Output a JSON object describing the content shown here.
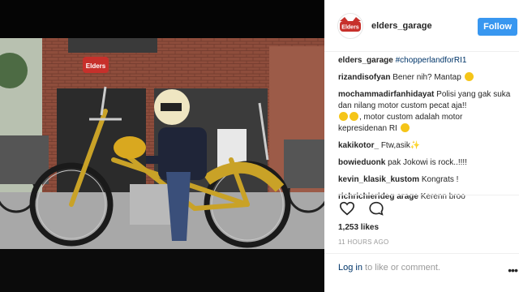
{
  "colors": {
    "accent": "#3897f0",
    "link": "#003569",
    "muted": "#999999",
    "text": "#262626"
  },
  "photo": {
    "shop_sign": "Elders",
    "icons": [
      "motorcycle-photo"
    ]
  },
  "header": {
    "avatar_text": "Elders",
    "username": "elders_garage",
    "follow_label": "Follow"
  },
  "caption": {
    "user": "elders_garage",
    "hashtag": "#chopperlandforRI1"
  },
  "comments": [
    {
      "user": "rizandisofyan",
      "text": "Bener nih? Mantap"
    },
    {
      "user": "mochammadirfanhidayat",
      "text": "Polisi yang gak suka dan nilang motor custom pecat aja!!",
      "text2": ", motor custom adalah motor kepresidenan RI"
    },
    {
      "user": "kakikotor_",
      "text": "Ftw,asik✨"
    },
    {
      "user": "bowieduonk",
      "text": "pak Jokowi is rock..!!!!"
    },
    {
      "user": "kevin_klasik_kustom",
      "text": "Kongrats !"
    },
    {
      "user": "richrichierideg arage",
      "text": "Kerenn broo"
    }
  ],
  "actions": {
    "icons": [
      "heart-icon",
      "comment-icon"
    ]
  },
  "likes": "1,253 likes",
  "timestamp": "11 HOURS AGO",
  "login": {
    "link": "Log in",
    "text": " to like or comment.",
    "more": "•••"
  }
}
